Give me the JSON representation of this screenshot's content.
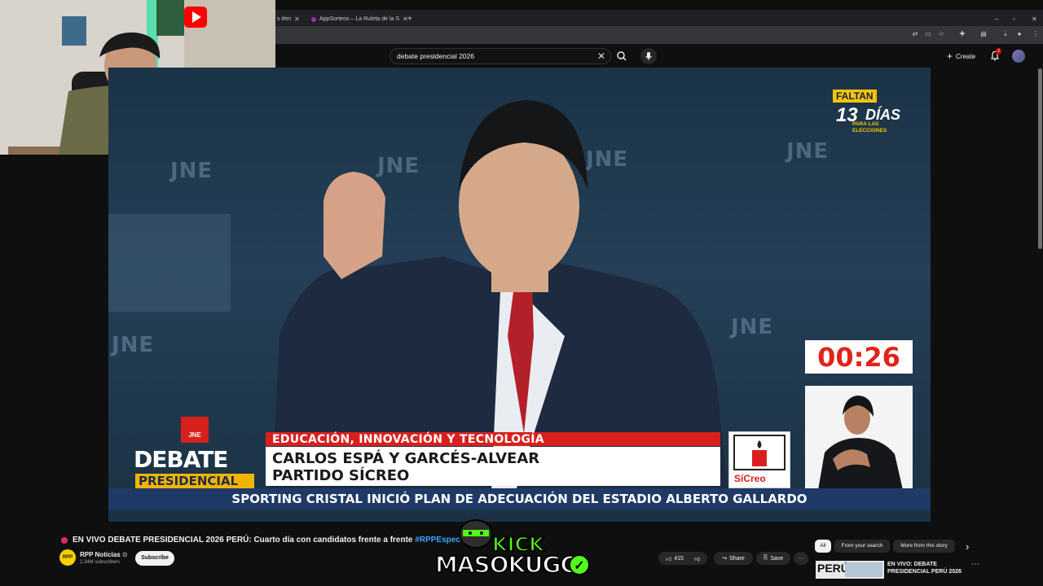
{
  "browser": {
    "tabs": [
      {
        "label": "s #en"
      },
      {
        "label": "AppSorteos – La Ruleta de la S"
      }
    ],
    "new_tab_symbol": "+",
    "window_controls": [
      "–",
      "▫",
      "✕"
    ]
  },
  "youtube_header": {
    "search_value": "debate presidencial 2026",
    "create_label": "Create",
    "notification_count": "2"
  },
  "video": {
    "watermark": "JNE",
    "countdown_top": "FALTAN",
    "countdown_number": "13",
    "countdown_unit": "DÍAS",
    "countdown_sub1": "PARA LAS",
    "countdown_sub2": "ELECCIONES",
    "timer": "00:26",
    "topic": "EDUCACIÓN, INNOVACIÓN Y TECNOLOGÍA",
    "candidate_name": "CARLOS ESPÁ Y GARCÉS-ALVEAR",
    "candidate_party": "PARTIDO SÍCREO",
    "party_logo_text": "SíCreo",
    "jne_logo_text": "JNE",
    "debate_word": "DEBATE",
    "presidencial_word": "PRESIDENCIAL",
    "ticker": "SPORTING CRISTAL INICIÓ PLAN DE ADECUACIÓN DEL ESTADIO ALBERTO GALLARDO"
  },
  "watch": {
    "title_main": "EN VIVO DEBATE PRESIDENCIAL 2026 PERÚ: Cuarto día con candidatos frente a frente ",
    "title_tag": "#RPPEspeciales",
    "channel_name": "RPP Noticias",
    "channel_avatar": "RPP",
    "channel_subs": "2.34M subscribers",
    "subscribe_label": "Subscribe",
    "like_count": "415",
    "share_label": "Share",
    "save_label": "Save",
    "more_label": "···"
  },
  "recommendations": {
    "chips": [
      "All",
      "From your search",
      "More from this story"
    ],
    "next_symbol": "›",
    "first_title_line1": "EN VIVO: DEBATE",
    "first_title_line2": "PRESIDENCIAL PERÚ 2026",
    "first_thumb_text": "PERÚ"
  },
  "overlay": {
    "kick_word": "KICK",
    "streamer_name": "MASOKUGG",
    "check_symbol": "✓"
  },
  "colors": {
    "accent_red": "#d8211d",
    "timer_red": "#e2231a",
    "kick_green": "#53fc18",
    "youtube_bg": "#0f0f0f",
    "link_blue": "#3ea6ff"
  }
}
